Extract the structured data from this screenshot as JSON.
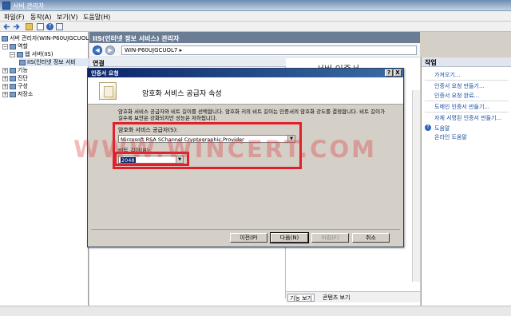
{
  "window": {
    "title": "서버 관리자"
  },
  "menu": [
    "파일(F)",
    "동작(A)",
    "보기(V)",
    "도움말(H)"
  ],
  "tree": {
    "root": "서버 관리자(WIN-P60UJGCUOL",
    "roles": "역할",
    "webserver": "웹 서버(IIS)",
    "iis": "IIS(인터넷 정보 서비",
    "features": "기능",
    "diagnostics": "진단",
    "configuration": "구성",
    "storage": "저장소"
  },
  "center": {
    "header": "IIS(인터넷 정보 서비스) 관리자",
    "address": "WIN-P60UJGCUOL7",
    "address_arrow": "▸",
    "connections_label": "연결",
    "panel_title": "서버 인증서",
    "view_tabs": [
      "기능 보기",
      "콘텐츠 보기"
    ]
  },
  "actions": {
    "header": "작업",
    "items": [
      "가져오기...",
      "인증서 요청 만들기...",
      "인증서 요청 완료...",
      "도메인 인증서 만들기...",
      "자체 서명된 인증서 만들기..."
    ],
    "help": [
      "도움말",
      "온라인 도움말"
    ]
  },
  "dialog": {
    "title": "인증서 요청",
    "help_btn": "?",
    "close_btn": "X",
    "heading": "암호화 서비스 공급자 속성",
    "description": "암호화 서비스 공급자와 비트 길이를 선택합니다. 암호화 키의 비트 길이는 인증서의 암호화 강도를 결정합니다. 비트 길이가 길수록 보안은 강화되지만 성능은 저하됩니다.",
    "csp_label": "암호화 서비스 공급자(S):",
    "csp_value": "Microsoft RSA SChannel Cryptographic Provider",
    "bitlen_label": "비트 길이(B):",
    "bitlen_value": "2048",
    "buttons": {
      "prev": "이전(P)",
      "next": "다음(N)",
      "finish": "마침(F)",
      "cancel": "취소"
    }
  },
  "watermark": "WWW.WINCERT.COM",
  "colors": {
    "highlight": "#e0202a",
    "title_blue": "#0a246a",
    "link": "#1b4fa0"
  }
}
